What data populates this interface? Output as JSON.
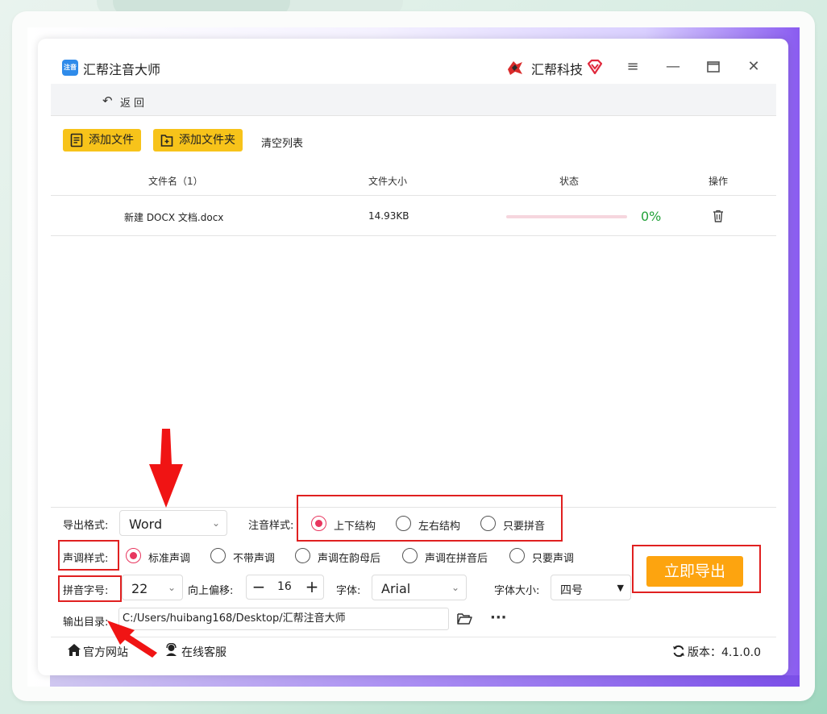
{
  "app": {
    "title": "汇帮注音大师",
    "logo_text": "注音",
    "brand": "汇帮科技",
    "window_controls": [
      "menu-icon",
      "minimize-icon",
      "maximize-icon",
      "close-icon"
    ]
  },
  "nav": {
    "back_label": "返回"
  },
  "toolbar": {
    "add_file": "添加文件",
    "add_folder": "添加文件夹",
    "clear_list": "清空列表"
  },
  "table": {
    "headers": [
      "文件名（1）",
      "文件大小",
      "状态",
      "操作"
    ],
    "rows": [
      {
        "name": "新建 DOCX 文档.docx",
        "size": "14.93KB",
        "progress": 0,
        "progress_text": "0%"
      }
    ]
  },
  "settings": {
    "export_format": {
      "label": "导出格式:",
      "value": "Word"
    },
    "annotation_style": {
      "label": "注音样式:",
      "options": [
        "上下结构",
        "左右结构",
        "只要拼音"
      ],
      "selected": "上下结构"
    },
    "tone_style": {
      "label": "声调样式:",
      "options": [
        "标准声调",
        "不带声调",
        "声调在韵母后",
        "声调在拼音后",
        "只要声调"
      ],
      "selected": "标准声调"
    },
    "pinyin_size": {
      "label": "拼音字号:",
      "value": "22"
    },
    "upward_offset": {
      "label": "向上偏移:",
      "value": "16",
      "minus": "−",
      "plus": "+"
    },
    "font": {
      "label": "字体:",
      "value": "Arial"
    },
    "font_size": {
      "label": "字体大小:",
      "value": "四号"
    },
    "output_dir": {
      "label": "输出目录:",
      "value": "C:/Users/huibang168/Desktop/汇帮注音大师"
    },
    "export_button": "立即导出"
  },
  "footer": {
    "website": "官方网站",
    "support": "在线客服",
    "version_label": "版本：",
    "version": "4.1.0.0"
  },
  "colors": {
    "accent_yellow": "#f7c31a",
    "export_orange": "#fda40f",
    "radio_pink": "#e8365e",
    "annotation_red": "#e02020",
    "progress_green": "#23a23a"
  }
}
